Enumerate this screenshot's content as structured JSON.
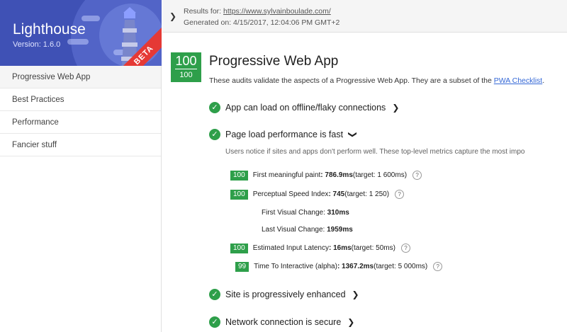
{
  "app": {
    "title": "Lighthouse",
    "version": "Version: 1.6.0",
    "badge": "BETA",
    "brand_color": "#3f51b5"
  },
  "sidebar": {
    "items": [
      {
        "label": "Progressive Web App",
        "active": true
      },
      {
        "label": "Best Practices"
      },
      {
        "label": "Performance"
      },
      {
        "label": "Fancier stuff"
      }
    ]
  },
  "header": {
    "results_prefix": "Results for: ",
    "url": "https://www.sylvainboulade.com/",
    "generated": "Generated on: 4/15/2017, 12:04:06 PM GMT+2"
  },
  "category": {
    "score": "100",
    "max": "100",
    "title": "Progressive Web App",
    "desc_prefix": "These audits validate the aspects of a Progressive Web App. They are a subset of the ",
    "link": "PWA Checklist",
    "desc_suffix": ".",
    "pass_color": "#2e9f4a"
  },
  "audits": [
    {
      "label": "App can load on offline/flaky connections"
    },
    {
      "label": "Page load performance is fast",
      "help": "Users notice if sites and apps don't perform well. These top-level metrics capture the most impo"
    },
    {
      "label": "Site is progressively enhanced"
    },
    {
      "label": "Network connection is secure"
    }
  ],
  "metrics": [
    {
      "score": "100",
      "name": "First meaningful paint",
      "value": ": 786.9ms",
      "target": " (target: 1 600ms)"
    },
    {
      "score": "100",
      "name": "Perceptual Speed Index",
      "value": ": 745",
      "target": " (target: 1 250)"
    },
    {
      "score": "100",
      "name": "Estimated Input Latency",
      "value": ": 16ms",
      "target": " (target: 50ms)"
    },
    {
      "score": "99",
      "name": "Time To Interactive (alpha)",
      "value": ": 1367.2ms",
      "target": " (target: 5 000ms)"
    }
  ],
  "sub_metrics": [
    {
      "name": "First Visual Change: ",
      "value": "310ms"
    },
    {
      "name": "Last Visual Change: ",
      "value": "1959ms"
    }
  ],
  "icons": {
    "check": "check-icon",
    "chevron": "chevron-right-icon",
    "help": "?"
  }
}
